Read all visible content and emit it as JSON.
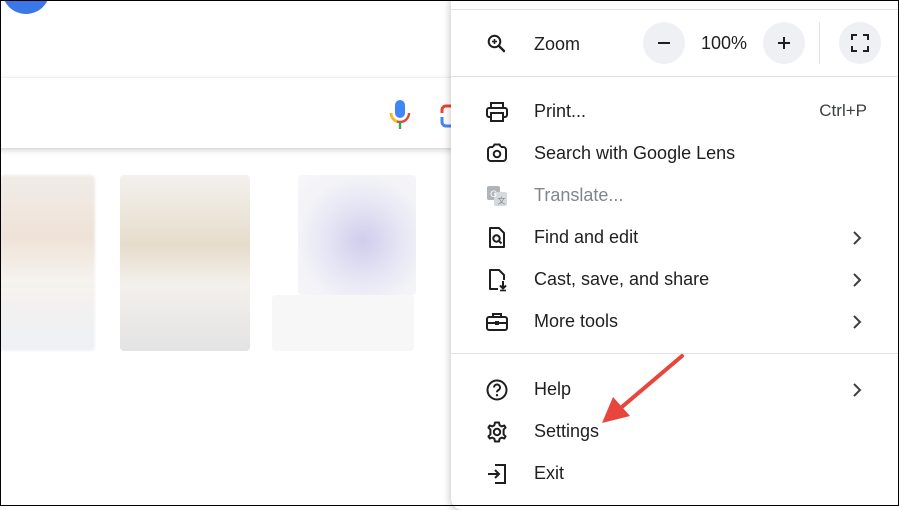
{
  "menu": {
    "zoom": {
      "label": "Zoom",
      "value": "100%",
      "minus_label": "−",
      "plus_label": "+"
    },
    "items": [
      {
        "name": "print",
        "label": "Print...",
        "shortcut": "Ctrl+P",
        "icon": "printer-icon"
      },
      {
        "name": "google-lens",
        "label": "Search with Google Lens",
        "icon": "google-lens-icon"
      },
      {
        "name": "translate",
        "label": "Translate...",
        "icon": "translate-icon",
        "disabled": true
      },
      {
        "name": "find-and-edit",
        "label": "Find and edit",
        "icon": "find-page-icon",
        "submenu": true
      },
      {
        "name": "cast-save-share",
        "label": "Cast, save, and share",
        "icon": "file-download-icon",
        "submenu": true
      },
      {
        "name": "more-tools",
        "label": "More tools",
        "icon": "toolbox-icon",
        "submenu": true
      },
      {
        "name": "help",
        "label": "Help",
        "icon": "help-icon",
        "submenu": true
      },
      {
        "name": "settings",
        "label": "Settings",
        "icon": "gear-icon"
      },
      {
        "name": "exit",
        "label": "Exit",
        "icon": "exit-icon"
      }
    ]
  },
  "annotation": {
    "arrow_color": "#e8453c",
    "arrow_target": "settings"
  },
  "colors": {
    "mic_blue": "#4285f4",
    "mic_red": "#ea4335",
    "mic_yellow": "#fbbc04",
    "mic_green": "#34a853"
  }
}
